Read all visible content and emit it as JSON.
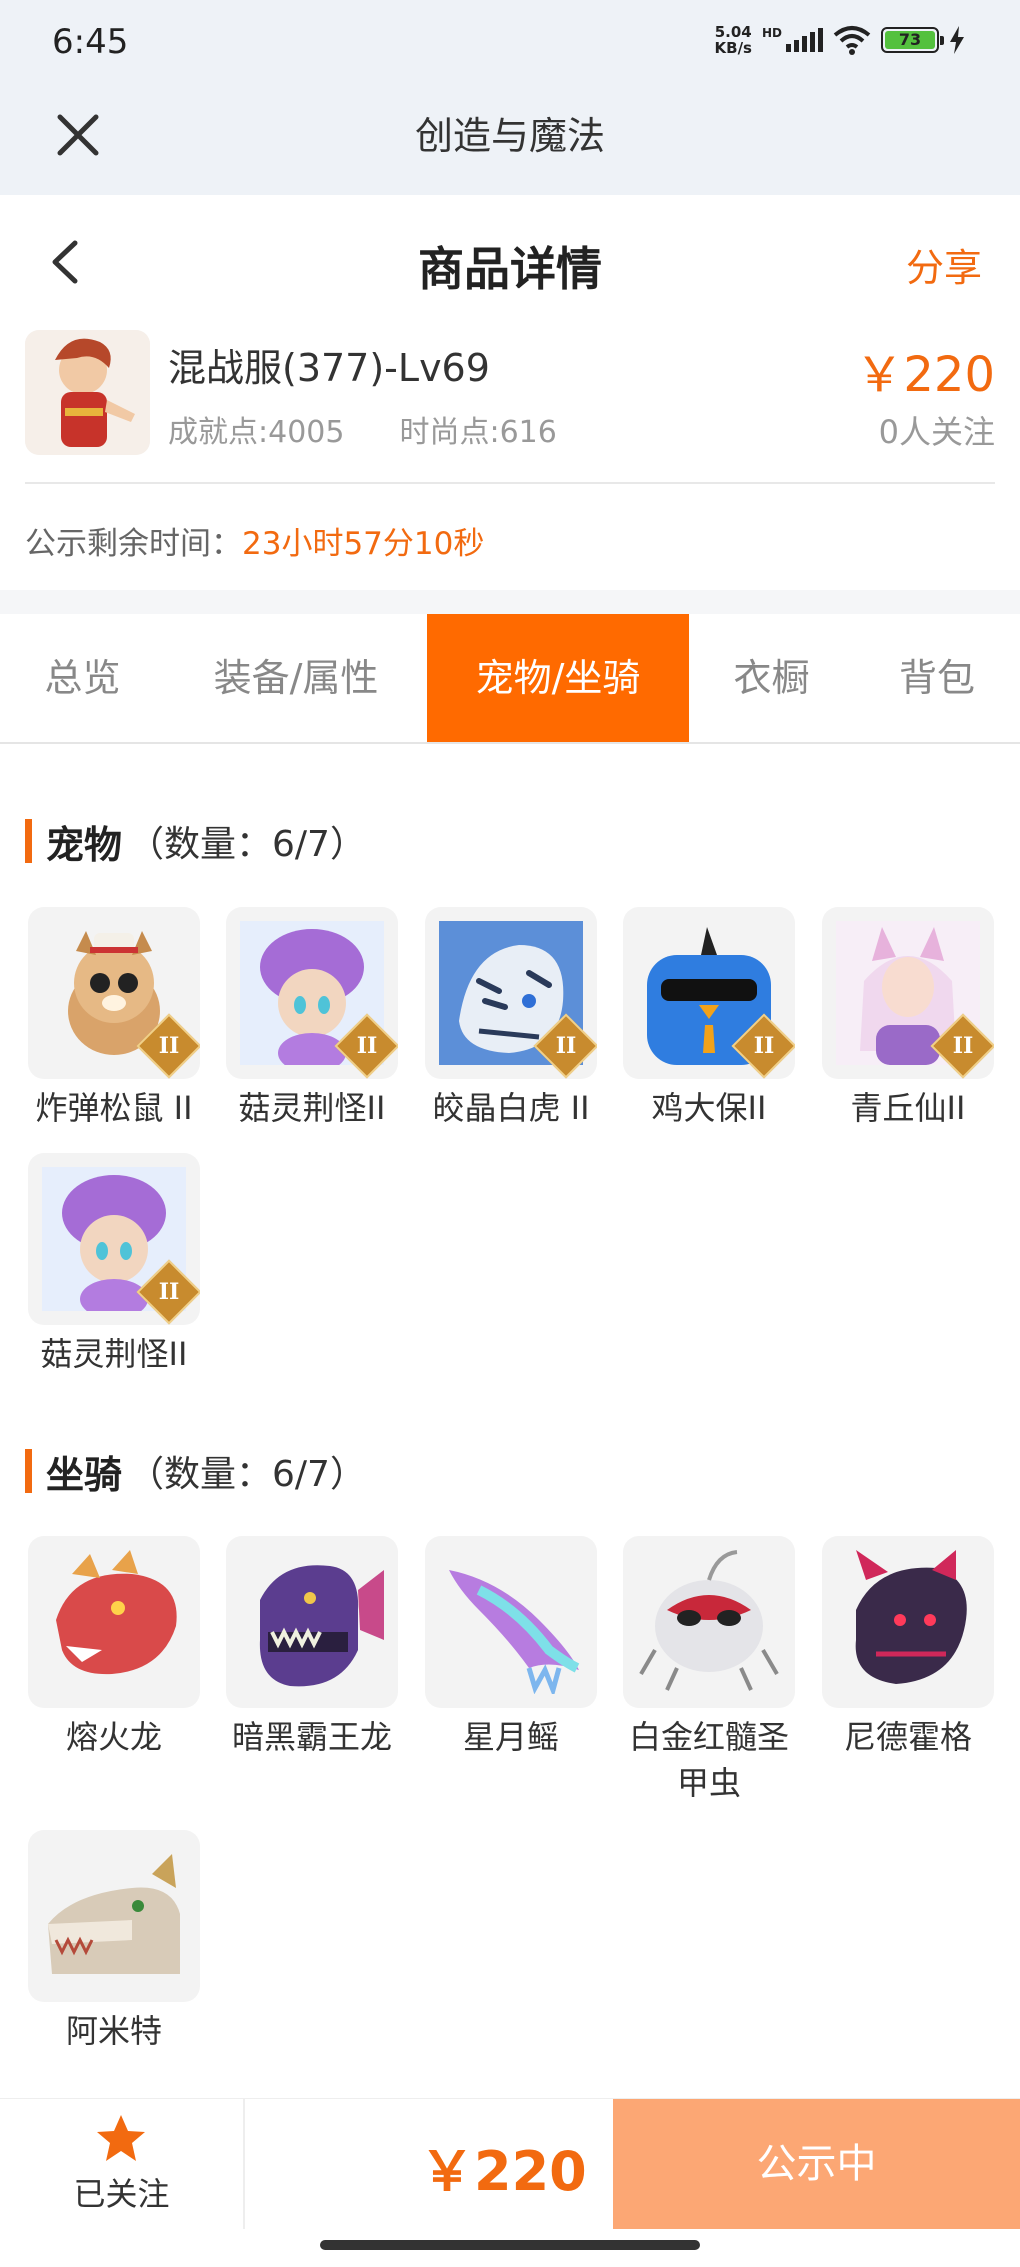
{
  "status_bar": {
    "time": "6:45",
    "speed_value": "5.04",
    "speed_unit": "KB/s",
    "network": "HD",
    "battery": "73"
  },
  "webview": {
    "title": "创造与魔法"
  },
  "header": {
    "title": "商品详情",
    "share_label": "分享"
  },
  "product": {
    "name": "混战服(377)-Lv69",
    "achievement": "成就点:4005",
    "fashion": "时尚点:616",
    "price": "￥220",
    "followers": "0人关注",
    "remain_label": "公示剩余时间：",
    "remain_value": "23小时57分10秒"
  },
  "tabs": [
    {
      "label": "总览",
      "active": false
    },
    {
      "label": "装备/属性",
      "active": false
    },
    {
      "label": "宠物/坐骑",
      "active": true
    },
    {
      "label": "衣橱",
      "active": false
    },
    {
      "label": "背包",
      "active": false
    }
  ],
  "pets": {
    "title": "宠物",
    "count": "（数量：6/7）",
    "items": [
      {
        "name": "炸弹松鼠 II",
        "badge": "II",
        "icon": "squirrel-pet-icon",
        "color": "#d9a36a"
      },
      {
        "name": "菇灵荆怪II",
        "badge": "II",
        "icon": "mushroom-sprite-pet-icon",
        "color": "#a56cd6"
      },
      {
        "name": "皎晶白虎 II",
        "badge": "II",
        "icon": "white-tiger-pet-icon",
        "color": "#5c8fd8"
      },
      {
        "name": "鸡大保II",
        "badge": "II",
        "icon": "blue-chicken-pet-icon",
        "color": "#2f7de0"
      },
      {
        "name": "青丘仙II",
        "badge": "II",
        "icon": "fox-fairy-pet-icon",
        "color": "#e7b2dc"
      },
      {
        "name": "菇灵荆怪II",
        "badge": "II",
        "icon": "mushroom-sprite-pet-icon",
        "color": "#a56cd6"
      }
    ]
  },
  "mounts": {
    "title": "坐骑",
    "count": "（数量：6/7）",
    "items": [
      {
        "name": "熔火龙",
        "icon": "fire-dragon-mount-icon",
        "color": "#d94a4a"
      },
      {
        "name": "暗黑霸王龙",
        "icon": "dark-trex-mount-icon",
        "color": "#5b3d8f"
      },
      {
        "name": "星月鳐",
        "icon": "star-ray-mount-icon",
        "color": "#7db6ee"
      },
      {
        "name": "白金红髓圣甲虫",
        "icon": "scarab-mount-icon",
        "color": "#c8c8c8"
      },
      {
        "name": "尼德霍格",
        "icon": "nidhogg-dragon-mount-icon",
        "color": "#3a2a4a"
      },
      {
        "name": "阿米特",
        "icon": "ammit-crocodile-mount-icon",
        "color": "#d8cbb8"
      }
    ]
  },
  "bottom": {
    "follow_label": "已关注",
    "price": "￥220",
    "button_label": "公示中"
  },
  "colors": {
    "accent": "#f26a10",
    "tab_active": "#ff6a00",
    "button": "#fca774"
  }
}
